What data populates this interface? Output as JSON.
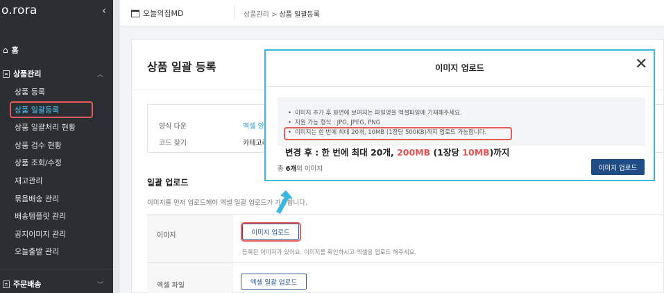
{
  "sidebar": {
    "logo": "o.rora",
    "collapse_icon": "‹",
    "home": "홈",
    "group1": "상품관리",
    "group2": "주문배송",
    "items": [
      {
        "label": "상품 등록"
      },
      {
        "label": "상품 일괄등록"
      },
      {
        "label": "상품 일괄처리 현황"
      },
      {
        "label": "상품 검수 현황"
      },
      {
        "label": "상품 조회/수정"
      },
      {
        "label": "재고관리"
      },
      {
        "label": "묶음배송 관리"
      },
      {
        "label": "배송템플릿 관리"
      },
      {
        "label": "공지이미지 관리"
      },
      {
        "label": "오늘출발 관리"
      }
    ],
    "active_color": "#4fc3f7"
  },
  "topbar": {
    "store": "오늘의집MD",
    "crumb_parent": "상품관리",
    "crumb_sep": ">",
    "crumb_current": "상품 일괄등록"
  },
  "main": {
    "title": "상품 일괄 등록",
    "info": {
      "row1_label": "양식 다운",
      "row1_value": "엑셀 양식",
      "row2_label": "코드 찾기",
      "row2_value": "카테고리"
    },
    "section_title": "일괄 업로드",
    "section_desc": "이미지를 먼저 업로드해야 엑셀 일괄 업로드가 가능합니다.",
    "rows": {
      "image_label": "이미지",
      "image_button": "이미지 업로드",
      "image_hint": "등록된 이미지가 있어요. 이미지를 확인하시고 엑셀을 업로드 해주세요.",
      "excel_label": "엑셀 파일",
      "excel_button": "엑셀 일괄 업로드"
    }
  },
  "modal": {
    "title": "이미지 업로드",
    "close": "✕",
    "notices": [
      "이미지 추가 후 화면에 보여지는 파일명을 엑셀파일에 기재해주세요.",
      "지원 가능 형식 : JPG, JPEG, PNG",
      "이미지는 한 번에 최대 20개, 10MB (1장당 500KB)까지 업로드 가능합니다."
    ],
    "changed": {
      "prefix": "변경 후 : 한 번에 최대 20개, ",
      "mb": "200MB",
      "mid": " (1장당 ",
      "per": "10MB",
      "suffix": ")까지"
    },
    "total_prefix": "총 ",
    "total_count": "6개",
    "total_suffix": "의 이미지",
    "upload_button": "이미지 업로드"
  },
  "colors": {
    "highlight_red": "#e65a5a",
    "modal_border": "#3ab7e1",
    "primary": "#1f4c82",
    "arrow": "#3ab7e1"
  }
}
